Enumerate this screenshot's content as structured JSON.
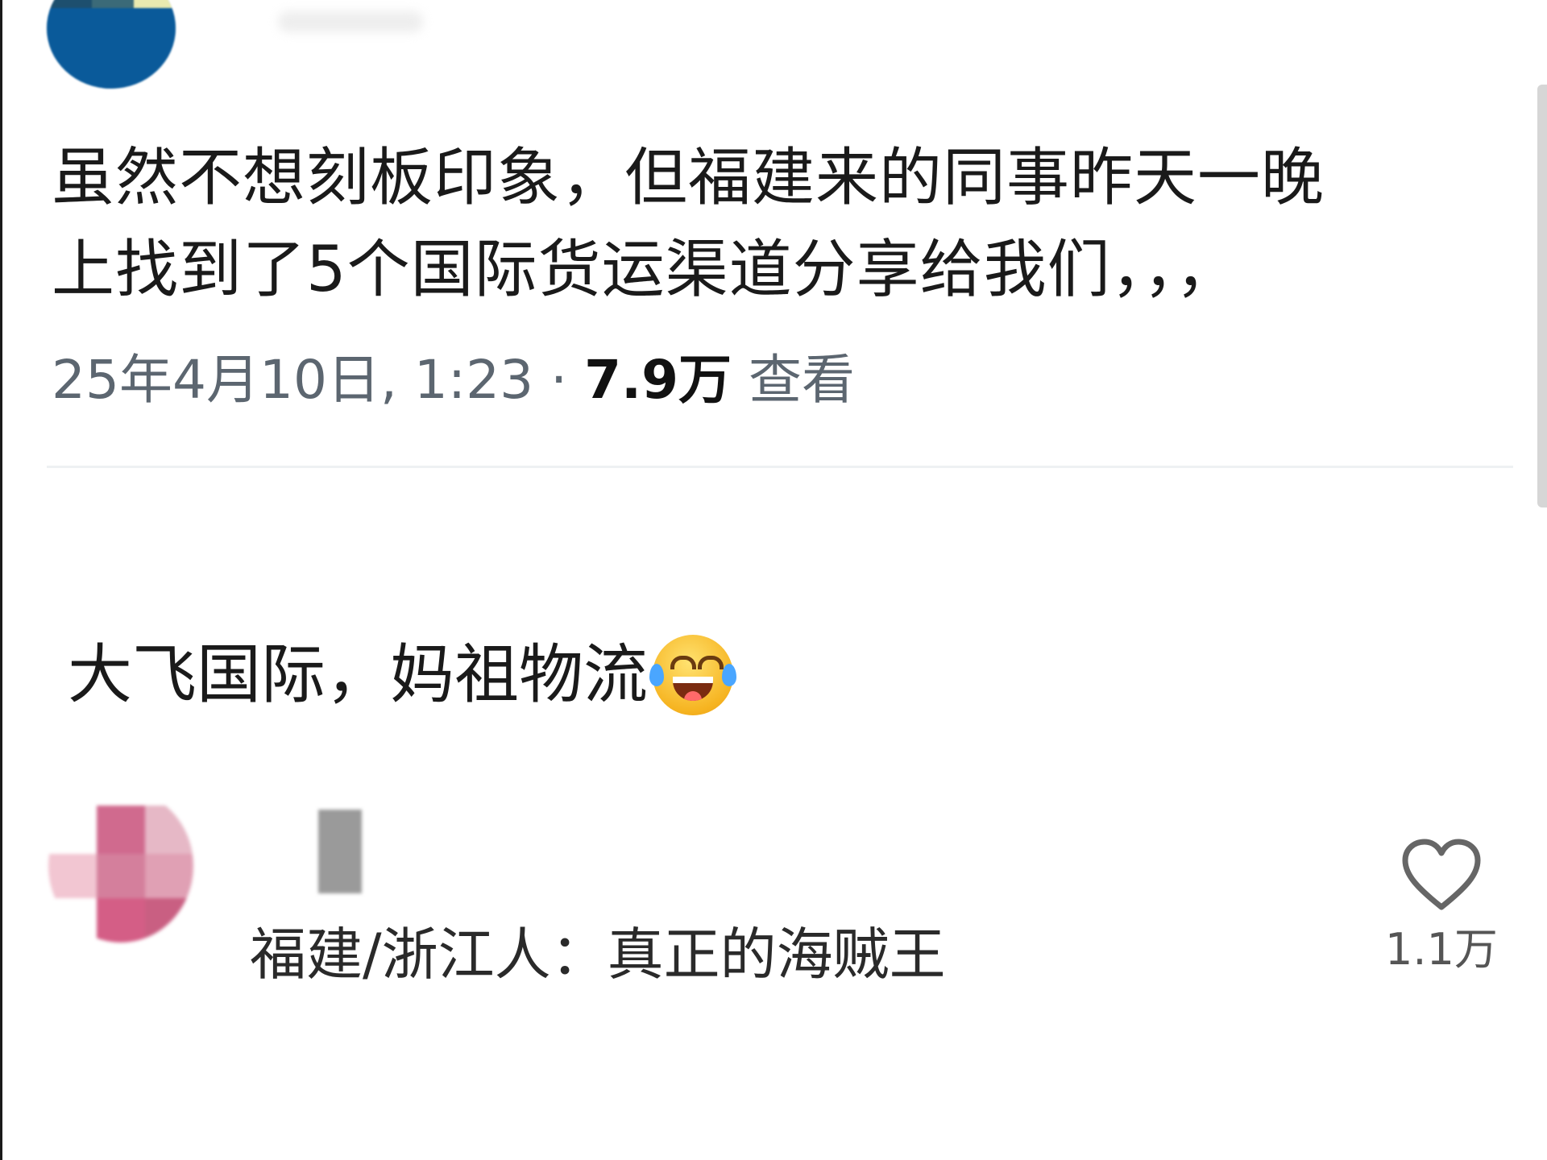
{
  "post": {
    "text_line1": "虽然不想刻板印象，但福建来的同事昨天一晚",
    "text_line2": "上找到了5个国际货运渠道分享给我们，，，",
    "timestamp": "25年4月10日, 1:23",
    "separator": " · ",
    "views_count": "7.9万",
    "views_label": " 查看"
  },
  "comment": {
    "text": "大飞国际，妈祖物流",
    "emoji": "face-with-tears-of-joy"
  },
  "reply": {
    "text": "福建/浙江人：真正的海贼王",
    "like_count": "1.1万",
    "like_icon": "heart-outline-icon"
  },
  "colors": {
    "text": "#1a1a1a",
    "meta": "#5c6670",
    "avatar_top": "#0a5a9a",
    "avatar_reply": "#d06a8e"
  }
}
